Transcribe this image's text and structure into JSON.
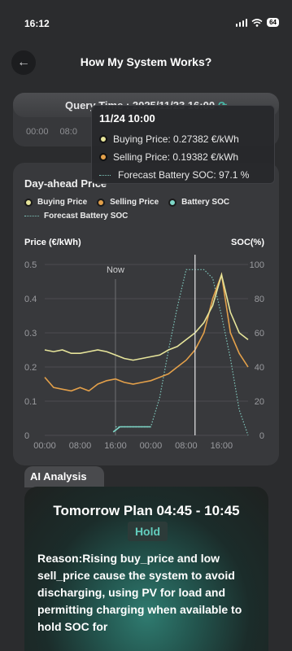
{
  "status": {
    "time": "16:12",
    "battery": "64"
  },
  "header": {
    "title": "How My System Works?"
  },
  "query": {
    "label": "Query Time : 2025/11/23 16:00",
    "times": [
      "00:00",
      "08:0"
    ]
  },
  "chart_card": {
    "title": "Day-ahead Price",
    "legend": [
      "Buying Price",
      "Selling Price",
      "Battery SOC",
      "Forecast Battery SOC"
    ]
  },
  "tooltip": {
    "title": "11/24 10:00",
    "buying": "Buying Price: 0.27382 €/kWh",
    "selling": "Selling Price: 0.19382 €/kWh",
    "forecast": "Forecast Battery SOC: 97.1 %"
  },
  "chart_data": {
    "type": "line",
    "ylabel": "Price (€/kWh)",
    "y2label": "SOC(%)",
    "ylim": [
      0,
      0.5
    ],
    "y2lim": [
      0,
      100
    ],
    "x_ticks": [
      "00:00",
      "08:00",
      "16:00",
      "00:00",
      "08:00",
      "16:00"
    ],
    "y_ticks": [
      "0",
      "0.1",
      "0.2",
      "0.3",
      "0.4",
      "0.5"
    ],
    "y2_ticks": [
      "0",
      "20",
      "40",
      "60",
      "80",
      "100"
    ],
    "annotation": "Now",
    "x_hours": [
      0,
      2,
      4,
      6,
      8,
      10,
      12,
      14,
      16,
      18,
      20,
      22,
      24,
      26,
      28,
      30,
      32,
      34,
      36,
      38,
      40,
      42,
      44,
      46
    ],
    "buying_price": [
      0.25,
      0.245,
      0.25,
      0.24,
      0.24,
      0.245,
      0.25,
      0.245,
      0.235,
      0.225,
      0.22,
      0.225,
      0.23,
      0.235,
      0.25,
      0.26,
      0.28,
      0.3,
      0.33,
      0.38,
      0.47,
      0.36,
      0.3,
      0.28
    ],
    "selling_price": [
      0.17,
      0.14,
      0.135,
      0.13,
      0.14,
      0.13,
      0.15,
      0.16,
      0.165,
      0.155,
      0.15,
      0.155,
      0.16,
      0.17,
      0.18,
      0.2,
      0.22,
      0.25,
      0.3,
      0.4,
      0.47,
      0.3,
      0.24,
      0.2
    ],
    "battery_soc": {
      "x_hours": [
        15.5,
        16,
        17,
        18,
        19,
        20,
        21,
        22,
        23,
        24
      ],
      "values": [
        2,
        3,
        5,
        5,
        5,
        5,
        5,
        5,
        5,
        5
      ]
    },
    "forecast_soc": {
      "x_hours": [
        16,
        24,
        26,
        28,
        30,
        32,
        34,
        36,
        38,
        40,
        42,
        44,
        46
      ],
      "values": [
        5,
        5,
        22,
        50,
        75,
        97,
        97,
        97,
        92,
        70,
        45,
        15,
        0
      ]
    },
    "now_hour": 16,
    "cursor_hour": 34
  },
  "ai": {
    "tab": "AI Analysis",
    "plan": "Tomorrow Plan 04:45 - 10:45",
    "action": "Hold",
    "reason": "Reason:Rising buy_price and low sell_price cause the system to avoid discharging, using PV for load and permitting charging when available to hold SOC for"
  },
  "colors": {
    "buying": "#e6e49a",
    "selling": "#e3a04a",
    "soc": "#7ed7c8",
    "accent": "#49c2b0"
  }
}
